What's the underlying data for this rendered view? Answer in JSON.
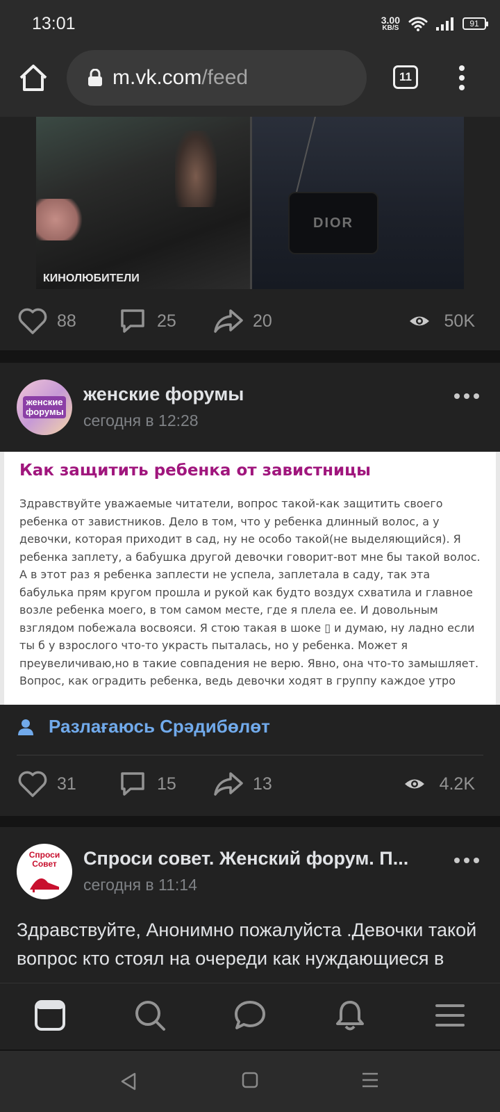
{
  "status_bar": {
    "time": "13:01",
    "net_speed_value": "3.00",
    "net_speed_unit": "KB/S",
    "battery": "91"
  },
  "browser": {
    "url_domain": "m.vk.com",
    "url_path": "/feed",
    "tab_count": "11"
  },
  "post1": {
    "photo_caption": "КИНОЛЮБИТЕЛИ",
    "bag_text": "DIOR",
    "likes": "88",
    "comments": "25",
    "shares": "20",
    "views": "50K"
  },
  "post2": {
    "author": "женские форумы",
    "avatar_text": "женские форумы",
    "time": "сегодня в 12:28",
    "article_title": "Как защитить ребенка от завистницы",
    "article_body": "Здравствуйте уважаемые читатели, вопрос такой-как защитить своего ребенка от завистников. Дело в том, что у ребенка длинный волос, а у девочки, которая приходит в сад, ну не особо такой(не выделяющийся). Я ребенка заплету, а бабушка другой девочки говорит-вот мне бы такой волос. А в этот раз я ребенка заплести не успела, заплетала в саду, так эта бабулька прям кругом прошла и рукой как будто воздух схватила и главное возле ребенка моего, в том самом месте, где я плела ее. И довольным взглядом побежала восвояси. Я стою такая в шоке ▯ и думаю, ну ладно если ты б у взрослого что-то украсть пыталась, но у ребенка. Может я преувеличиваю,но в такие совпадения не верю. Явно, она что-то замышляет. Вопрос, как оградить ребенка, ведь девочки ходят в группу каждое утро",
    "signed_author": "Разлағаюсь Срәдибөлөт",
    "likes": "31",
    "comments": "15",
    "shares": "13",
    "views": "4.2K"
  },
  "post3": {
    "author": "Спроси совет. Женский форум. П...",
    "avatar_text": "Спроси Совет",
    "time": "сегодня в 11:14",
    "text": "Здравствуйте, Анонимно пожалуйста .Девочки такой вопрос кто стоял на очереди как нуждающиеся в улучшении жилищных"
  },
  "colors": {
    "accent": "#71aaeb",
    "card_bg": "#222222",
    "page_bg": "#141414",
    "article_title": "#a0167d"
  },
  "icons": [
    "home-icon",
    "lock-icon",
    "more-icon",
    "like-icon",
    "comment-icon",
    "share-icon",
    "views-icon",
    "user-icon",
    "news-icon",
    "search-icon",
    "messages-icon",
    "notifications-icon",
    "menu-icon"
  ]
}
